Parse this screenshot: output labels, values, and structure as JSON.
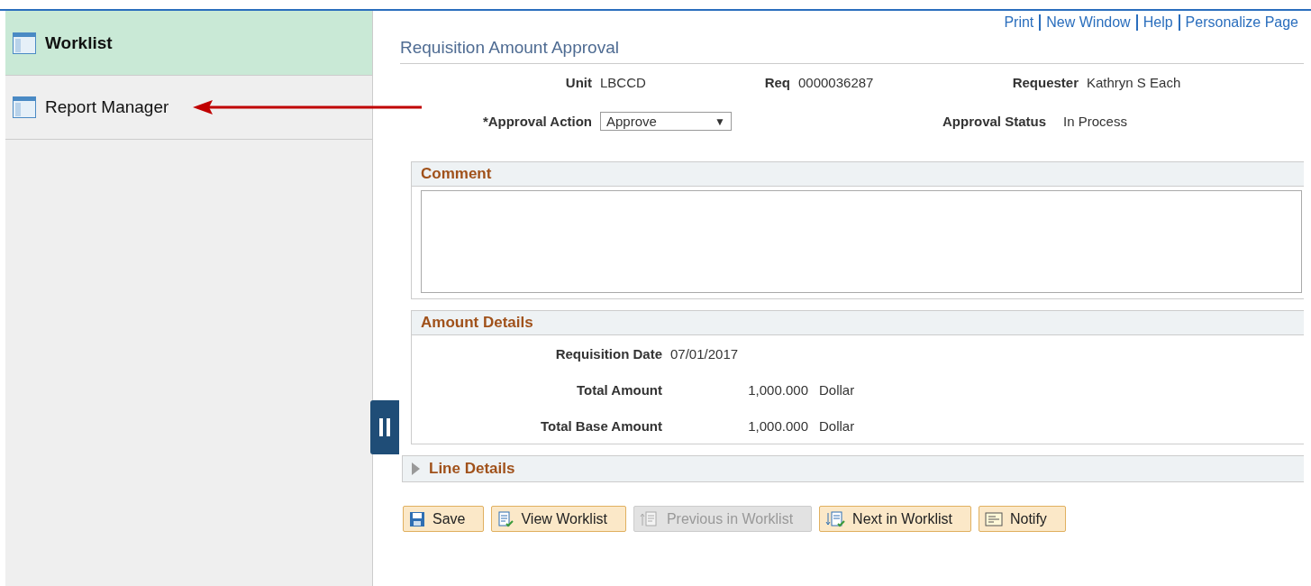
{
  "sidebar": {
    "items": [
      {
        "label": "Worklist",
        "selected": true
      },
      {
        "label": "Report Manager",
        "selected": false
      }
    ]
  },
  "header_links": [
    "Print",
    "New Window",
    "Help",
    "Personalize Page"
  ],
  "title": "Requisition Amount Approval",
  "fields_row_1": [
    {
      "label": "Unit",
      "value": "LBCCD"
    },
    {
      "label": "Req",
      "value": "0000036287"
    },
    {
      "label": "Requester",
      "value": "Kathryn S Each"
    }
  ],
  "approval_action": {
    "label": "*Approval Action",
    "value": "Approve",
    "arrow": "▼"
  },
  "approval_status": {
    "label": "Approval Status",
    "value": "In Process"
  },
  "comment": {
    "title": "Comment"
  },
  "amount_details": {
    "title": "Amount Details",
    "rows": [
      {
        "label": "Requisition Date",
        "value": "07/01/2017"
      },
      {
        "label": "Total Amount",
        "amount": "1,000.000",
        "currency": "Dollar"
      },
      {
        "label": "Total Base Amount",
        "amount": "1,000.000",
        "currency": "Dollar"
      }
    ]
  },
  "line_details": {
    "title": "Line Details",
    "expanded": false
  },
  "buttons": [
    {
      "label": "Save",
      "kind": "save",
      "disabled": false
    },
    {
      "label": "View Worklist",
      "kind": "list",
      "disabled": false
    },
    {
      "label": "Previous in Worklist",
      "kind": "prev",
      "disabled": true
    },
    {
      "label": "Next in Worklist",
      "kind": "next",
      "disabled": false
    },
    {
      "label": "Notify",
      "kind": "notify",
      "disabled": false
    }
  ]
}
